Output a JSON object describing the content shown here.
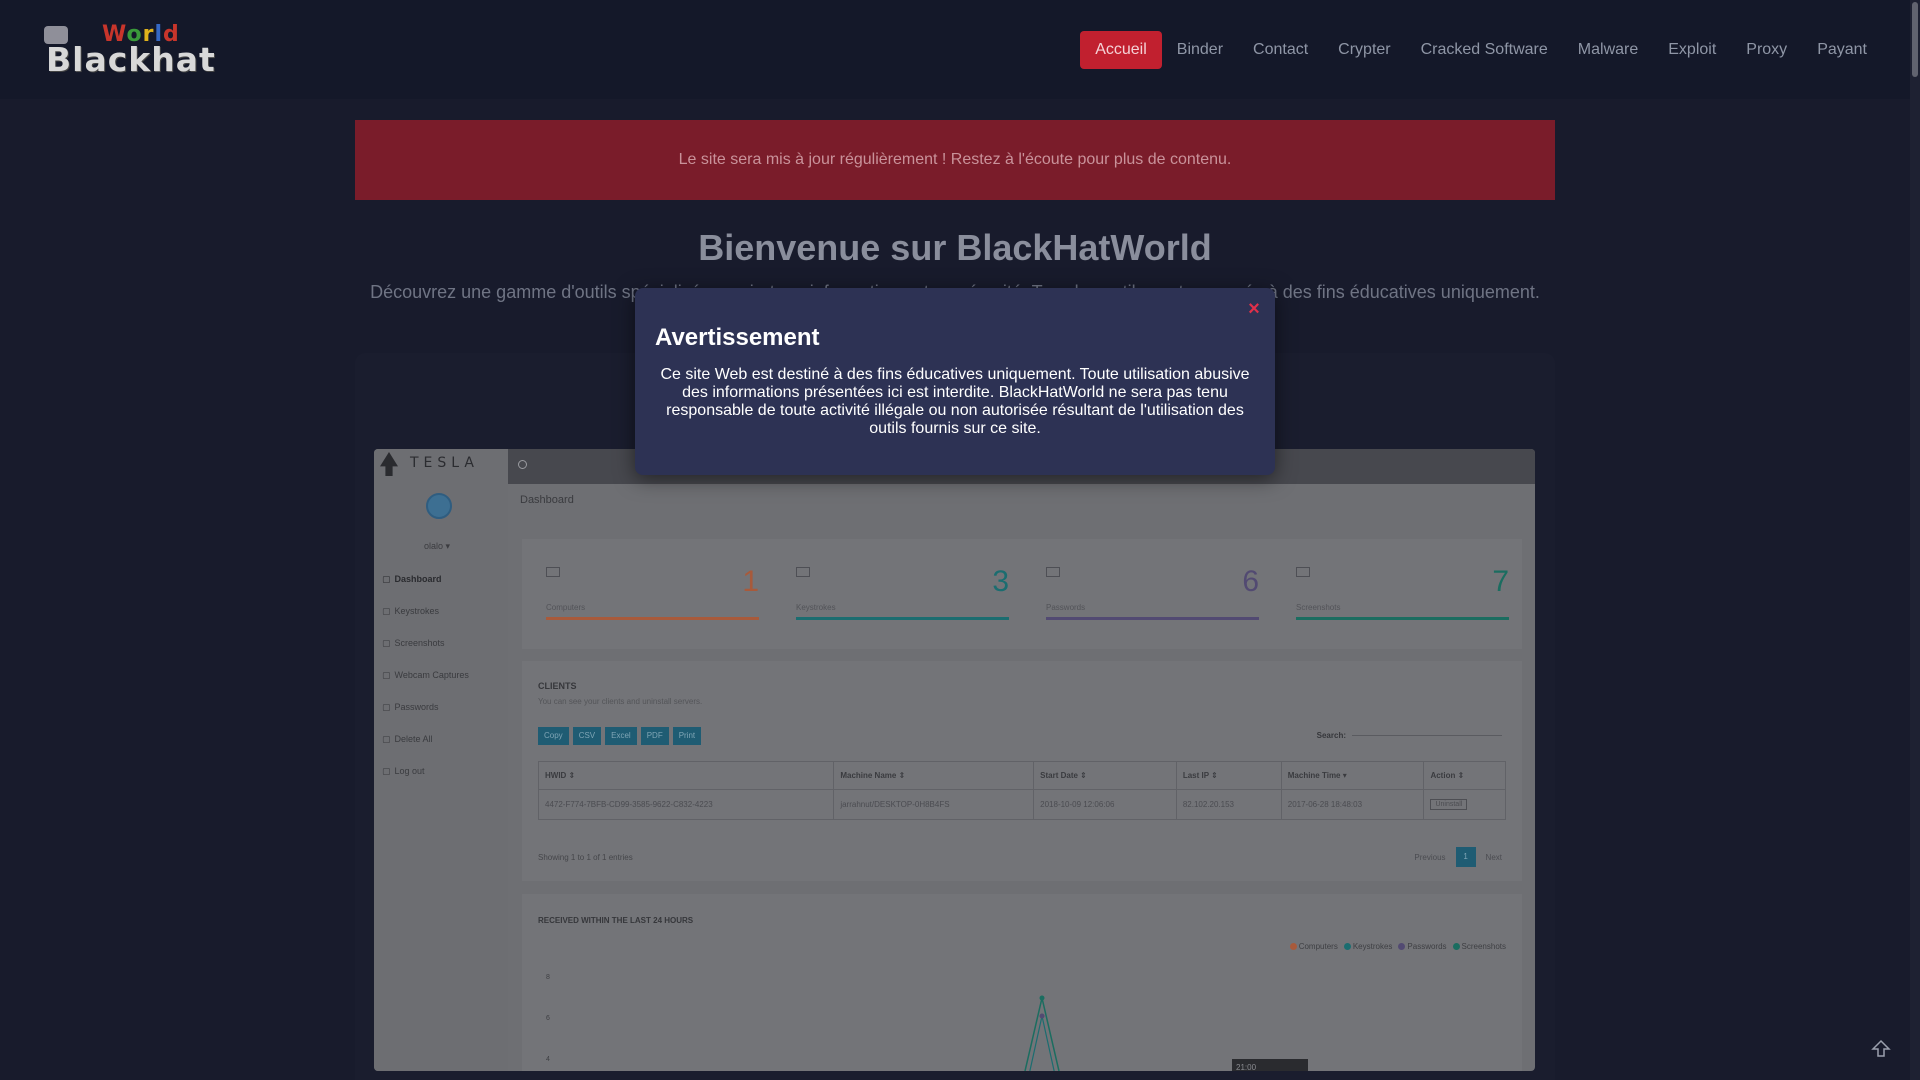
{
  "logo": {
    "top_text": "World",
    "main_text": "Blackhat"
  },
  "nav": {
    "items": [
      {
        "label": "Accueil",
        "active": true
      },
      {
        "label": "Binder"
      },
      {
        "label": "Contact"
      },
      {
        "label": "Crypter"
      },
      {
        "label": "Cracked Software"
      },
      {
        "label": "Malware"
      },
      {
        "label": "Exploit"
      },
      {
        "label": "Proxy"
      },
      {
        "label": "Payant"
      }
    ]
  },
  "alert": {
    "text": "Le site sera mis à jour régulièrement ! Restez à l'écoute pour plus de contenu."
  },
  "hero": {
    "title": "Bienvenue sur BlackHatWorld",
    "subtitle": "Découvrez une gamme d'outils spécialisés en piratage informatique et en sécurité. Tous les outils sont proposés à des fins éducatives uniquement."
  },
  "modal": {
    "title": "Avertissement",
    "close_symbol": "×",
    "body": "Ce site Web est destiné à des fins éducatives uniquement. Toute utilisation abusive des informations présentées ici est interdite. BlackHatWorld ne sera pas tenu responsable de toute activité illégale ou non autorisée résultant de l'utilisation des outils fournis sur ce site."
  },
  "screenshot": {
    "brand": "TESLA",
    "user": "olalo ▾",
    "sidebar": [
      "Dashboard",
      "Keystrokes",
      "Screenshots",
      "Webcam Captures",
      "Passwords",
      "Delete All",
      "Log out"
    ],
    "page_title": "Dashboard",
    "stats": [
      {
        "label": "Computers",
        "value": "1",
        "color": "#a85a3b"
      },
      {
        "label": "Keystrokes",
        "value": "3",
        "color": "#1b6d70"
      },
      {
        "label": "Passwords",
        "value": "6",
        "color": "#524a72"
      },
      {
        "label": "Screenshots",
        "value": "7",
        "color": "#1b6d60"
      }
    ],
    "clients": {
      "title": "CLIENTS",
      "subtitle": "You can see your clients and uninstall servers.",
      "buttons": [
        "Copy",
        "CSV",
        "Excel",
        "PDF",
        "Print"
      ],
      "search_label": "Search:",
      "columns": [
        "HWID ⇕",
        "Machine Name ⇕",
        "Start Date ⇕",
        "Last IP ⇕",
        "Machine Time ▾",
        "Action ⇕"
      ],
      "rows": [
        [
          "4472-F774-7BFB-CD99-3585-9622-C832-4223",
          "jarrahnut/DESKTOP-0H8B4FS",
          "2018-10-09 12:06:06",
          "82.102.20.153",
          "2017-06-28 18:48:03",
          "Uninstall"
        ]
      ],
      "showing": "Showing 1 to 1 of 1 entries",
      "prev": "Previous",
      "page": "1",
      "next": "Next"
    },
    "chart": {
      "title": "RECEIVED WITHIN THE LAST 24 HOURS",
      "legend": [
        {
          "name": "Computers",
          "color": "#a85a3b"
        },
        {
          "name": "Keystrokes",
          "color": "#1b6d70"
        },
        {
          "name": "Passwords",
          "color": "#524a72"
        },
        {
          "name": "Screenshots",
          "color": "#1b6d60"
        }
      ],
      "y_ticks": [
        "8",
        "6",
        "4"
      ],
      "tooltip": "21:00"
    }
  }
}
